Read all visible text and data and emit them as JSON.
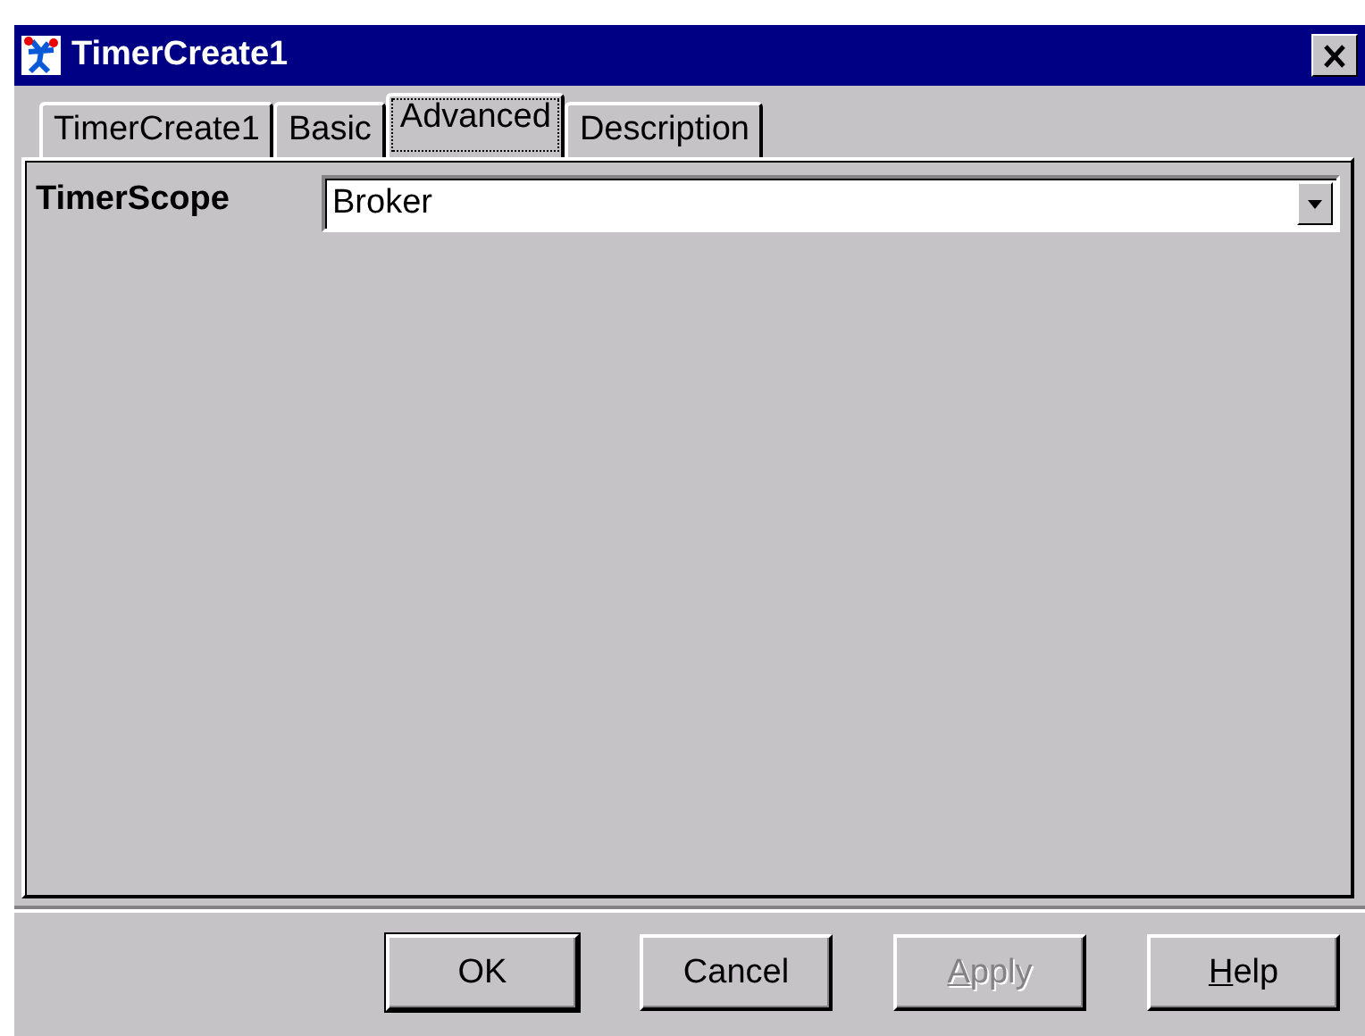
{
  "window": {
    "title": "TimerCreate1"
  },
  "tabs": [
    {
      "label": "TimerCreate1",
      "selected": false
    },
    {
      "label": "Basic",
      "selected": false
    },
    {
      "label": "Advanced",
      "selected": true
    },
    {
      "label": "Description",
      "selected": false
    }
  ],
  "fields": [
    {
      "label": "TimerScope",
      "value": "Broker"
    }
  ],
  "buttons": [
    {
      "label": "OK",
      "default": true,
      "disabled": false,
      "underline_first": false
    },
    {
      "label": "Cancel",
      "default": false,
      "disabled": false,
      "underline_first": false
    },
    {
      "label": "Apply",
      "default": false,
      "disabled": true,
      "underline_first": true
    },
    {
      "label": "Help",
      "default": false,
      "disabled": false,
      "underline_first": true
    }
  ]
}
